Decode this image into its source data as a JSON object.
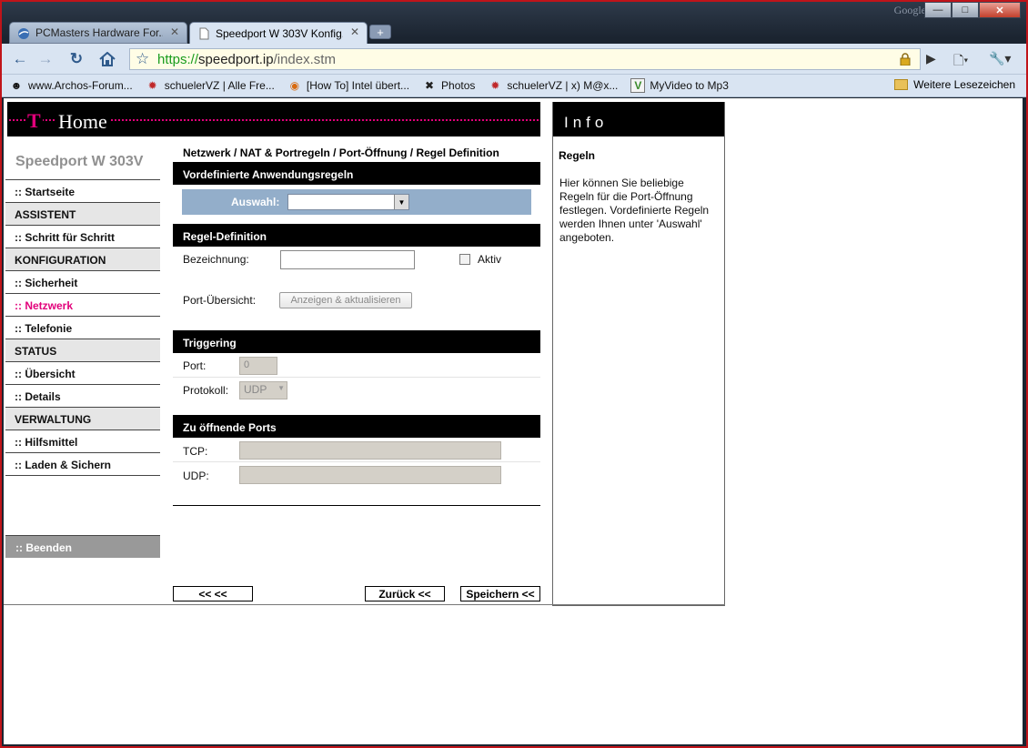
{
  "browser": {
    "google_mark": "Google",
    "tabs": [
      {
        "label": "PCMasters Hardware For...",
        "active": false
      },
      {
        "label": "Speedport W 303V Konfig...",
        "active": true
      }
    ],
    "url_scheme": "https://",
    "url_domain": "speedport.ip",
    "url_path": "/index.stm",
    "bookmarks": [
      {
        "label": "www.Archos-Forum...",
        "icon": "archos-face-icon"
      },
      {
        "label": "schuelerVZ | Alle Fre...",
        "icon": "schuelervz-icon"
      },
      {
        "label": "[How To] Intel übert...",
        "icon": "howto-icon"
      },
      {
        "label": "Photos",
        "icon": "photos-icon"
      },
      {
        "label": "schuelerVZ | x) M@x...",
        "icon": "schuelervz-icon"
      },
      {
        "label": "MyVideo to Mp3",
        "icon": "myvideo-icon"
      }
    ],
    "bookmark_folder": "Weitere Lesezeichen"
  },
  "header": {
    "logo": "T",
    "title": "Home"
  },
  "sidebar": {
    "product": "Speedport W 303V",
    "items": [
      {
        "label": ":: Startseite",
        "type": "link"
      },
      {
        "label": "ASSISTENT",
        "type": "section"
      },
      {
        "label": ":: Schritt für Schritt",
        "type": "link"
      },
      {
        "label": "KONFIGURATION",
        "type": "section"
      },
      {
        "label": ":: Sicherheit",
        "type": "link"
      },
      {
        "label": ":: Netzwerk",
        "type": "current"
      },
      {
        "label": ":: Telefonie",
        "type": "link"
      },
      {
        "label": "STATUS",
        "type": "section"
      },
      {
        "label": ":: Übersicht",
        "type": "link"
      },
      {
        "label": ":: Details",
        "type": "link"
      },
      {
        "label": "VERWALTUNG",
        "type": "section"
      },
      {
        "label": ":: Hilfsmittel",
        "type": "link"
      },
      {
        "label": ":: Laden & Sichern",
        "type": "link"
      }
    ],
    "end": ":: Beenden"
  },
  "main": {
    "breadcrumb": "Netzwerk / NAT & Portregeln / Port-Öffnung / Regel Definition",
    "predefined": {
      "heading": "Vordefinierte Anwendungsregeln",
      "select_label": "Auswahl:",
      "select_value": ""
    },
    "rule": {
      "heading": "Regel-Definition",
      "name_label": "Bezeichnung:",
      "name_value": "",
      "active_label": "Aktiv",
      "ports_label": "Port-Übersicht:",
      "ports_button": "Anzeigen & aktualisieren"
    },
    "triggering": {
      "heading": "Triggering",
      "port_label": "Port:",
      "port_value": "0",
      "protocol_label": "Protokoll:",
      "protocol_value": "UDP"
    },
    "open_ports": {
      "heading": "Zu öffnende Ports",
      "tcp_label": "TCP:",
      "udp_label": "UDP:"
    },
    "buttons": {
      "back_back": "<<  <<",
      "back": "Zurück <<",
      "save": "Speichern <<"
    }
  },
  "info": {
    "heading": "Info",
    "title": "Regeln",
    "text": "Hier können Sie beliebige Regeln für die Port-Öffnung festlegen. Vordefinierte Regeln werden Ihnen unter 'Auswahl' angeboten."
  },
  "colors": {
    "telekom_magenta": "#e2007a",
    "select_bar": "#93aeca",
    "disabled_field": "#d4d0c8"
  }
}
